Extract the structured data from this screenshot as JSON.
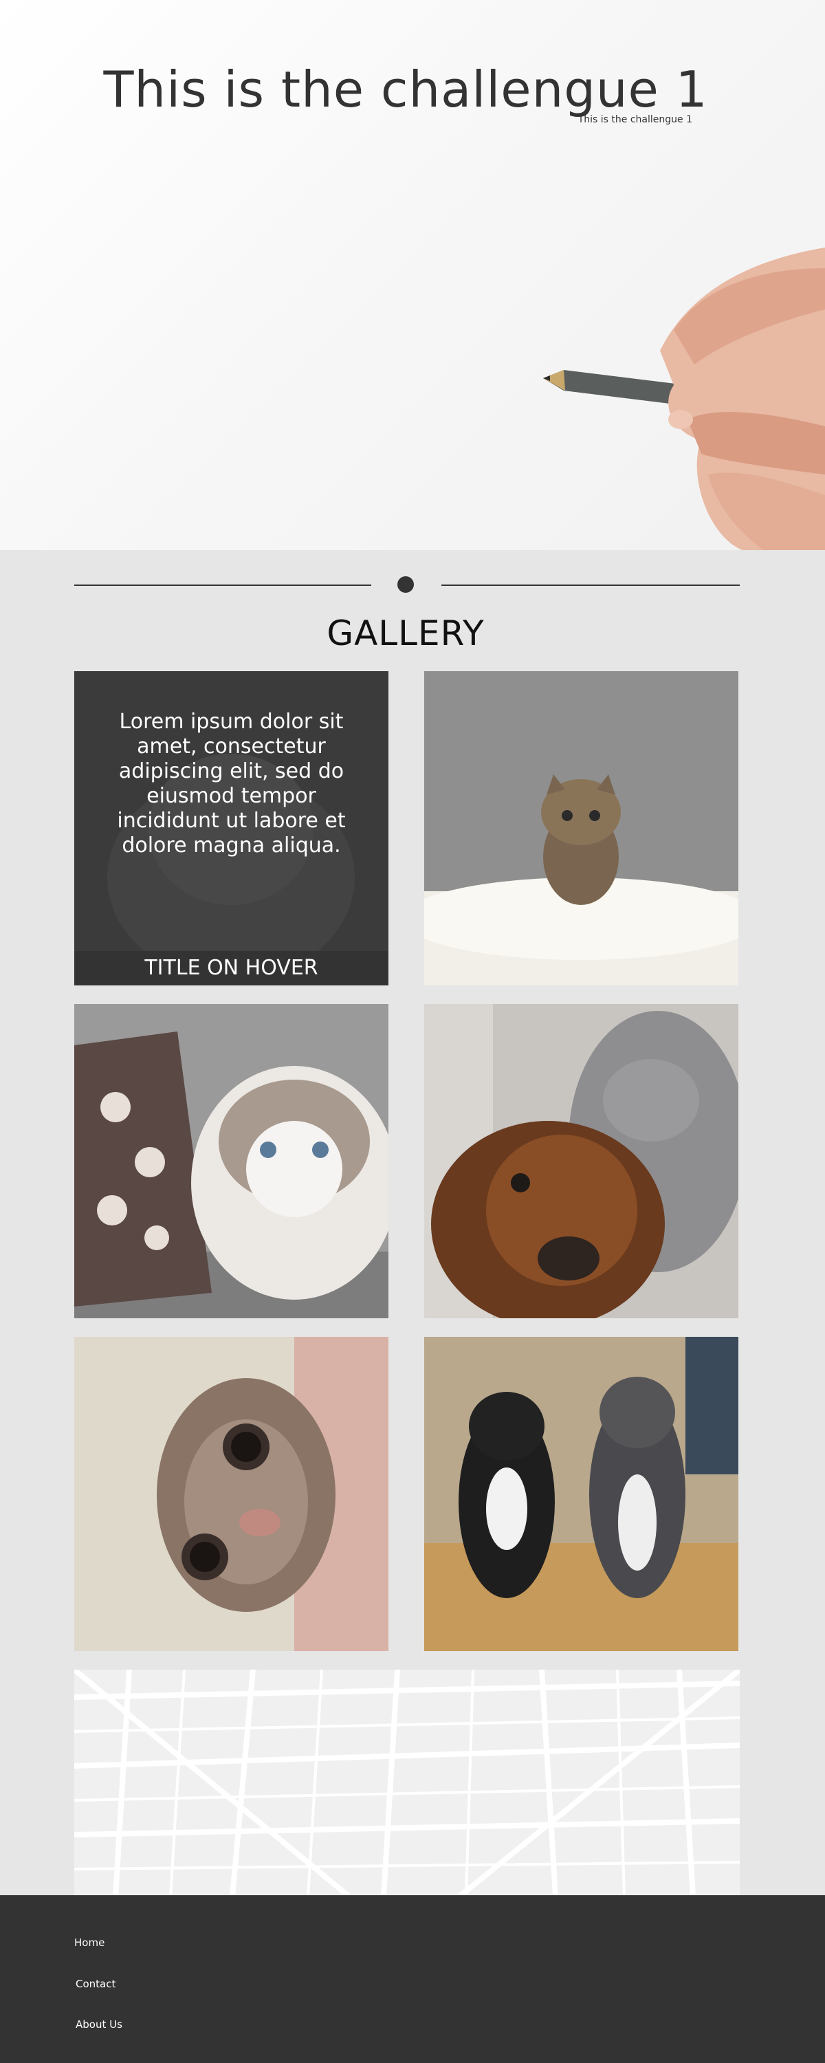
{
  "hero": {
    "title": "This is the challengue 1",
    "subtitle": "This is the challengue 1"
  },
  "gallery": {
    "title": "GALLERY",
    "hover_tile": {
      "text": "Lorem ipsum dolor sit amet, consectetur adipiscing elit, sed do eiusmod tempor incididunt ut labore et dolore magna aliqua.",
      "title": "TITLE ON HOVER"
    },
    "images": [
      {
        "subject": "kitten-in-feathers"
      },
      {
        "subject": "ragdoll-cat-with-pillow"
      },
      {
        "subject": "cat-and-dachshund"
      },
      {
        "subject": "cat-peeking-behind-door"
      },
      {
        "subject": "two-kittens-on-chair"
      }
    ]
  },
  "map": {
    "subject": "street-map"
  },
  "footer": {
    "links": [
      "Home",
      "Contact",
      "About Us"
    ]
  },
  "colors": {
    "dark": "#333333",
    "page_background": "#e6e6e6",
    "white": "#ffffff"
  }
}
